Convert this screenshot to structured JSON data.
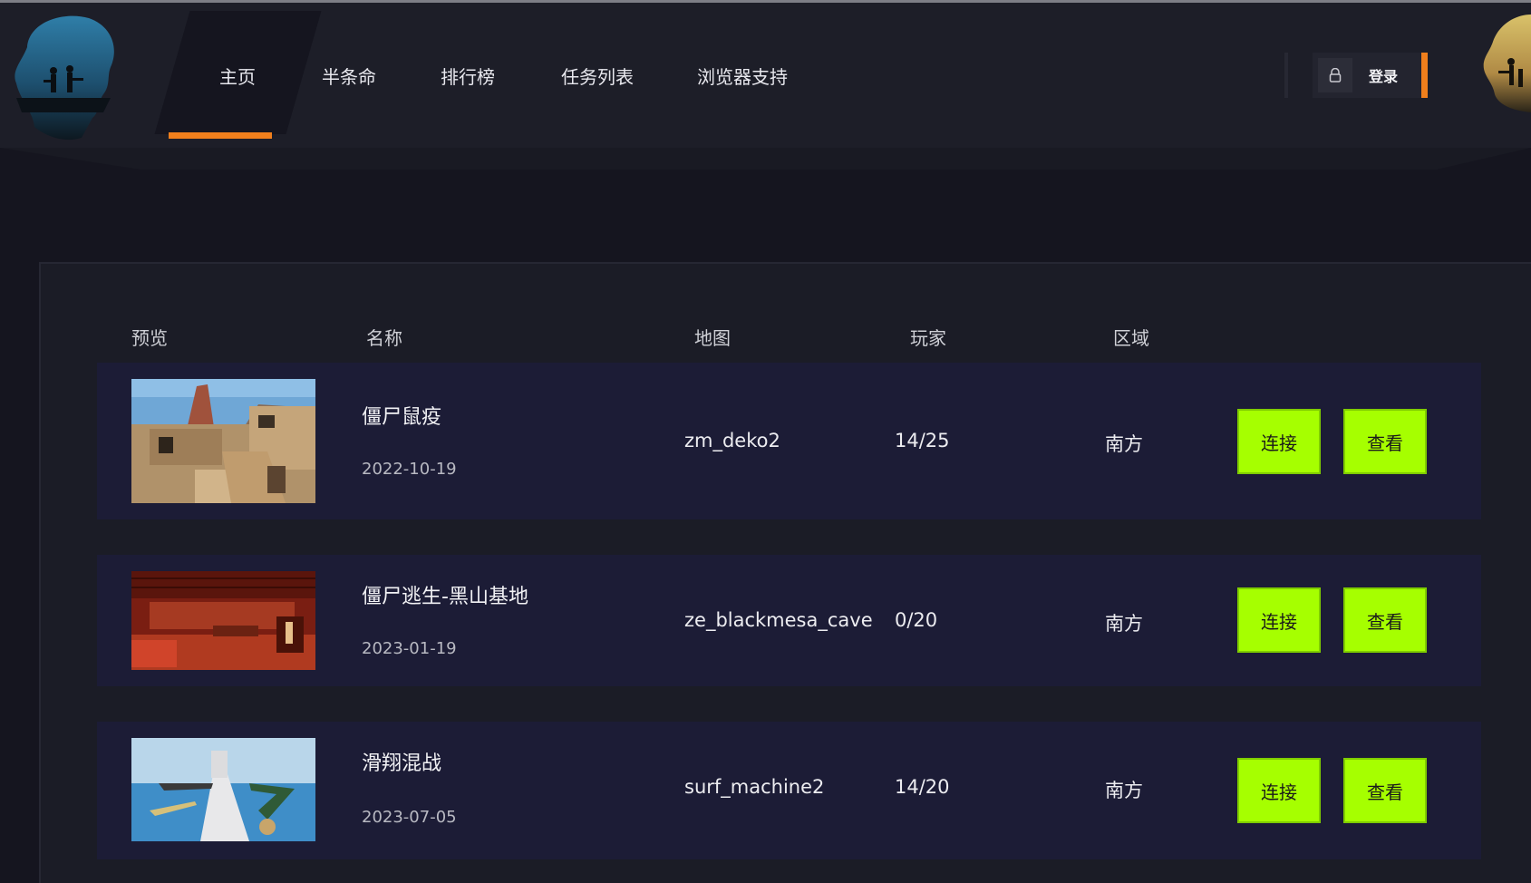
{
  "nav": {
    "items": [
      {
        "label": "主页",
        "active": true
      },
      {
        "label": "半条命"
      },
      {
        "label": "排行榜"
      },
      {
        "label": "任务列表"
      },
      {
        "label": "浏览器支持"
      }
    ],
    "login_label": "登录",
    "login_icon": "lock-icon"
  },
  "colors": {
    "accent": "#f07f1c",
    "button": "#a6ff00",
    "row_bg": "#1c1c36",
    "page_bg": "#15151f"
  },
  "table": {
    "headers": [
      "预览",
      "名称",
      "地图",
      "玩家",
      "区域"
    ],
    "rows": [
      {
        "name": "僵尸鼠疫",
        "date": "2022-10-19",
        "map": "zm_deko2",
        "players": "14/25",
        "region": "南方",
        "connect": "连接",
        "view": "查看",
        "preview": "desert-map-preview"
      },
      {
        "name": "僵尸逃生-黑山基地",
        "date": "2023-01-19",
        "map": "ze_blackmesa_cave",
        "players": "0/20",
        "region": "南方",
        "connect": "连接",
        "view": "查看",
        "preview": "red-warehouse-preview"
      },
      {
        "name": "滑翔混战",
        "date": "2023-07-05",
        "map": "surf_machine2",
        "players": "14/20",
        "region": "南方",
        "connect": "连接",
        "view": "查看",
        "preview": "surf-ramp-preview"
      }
    ]
  }
}
